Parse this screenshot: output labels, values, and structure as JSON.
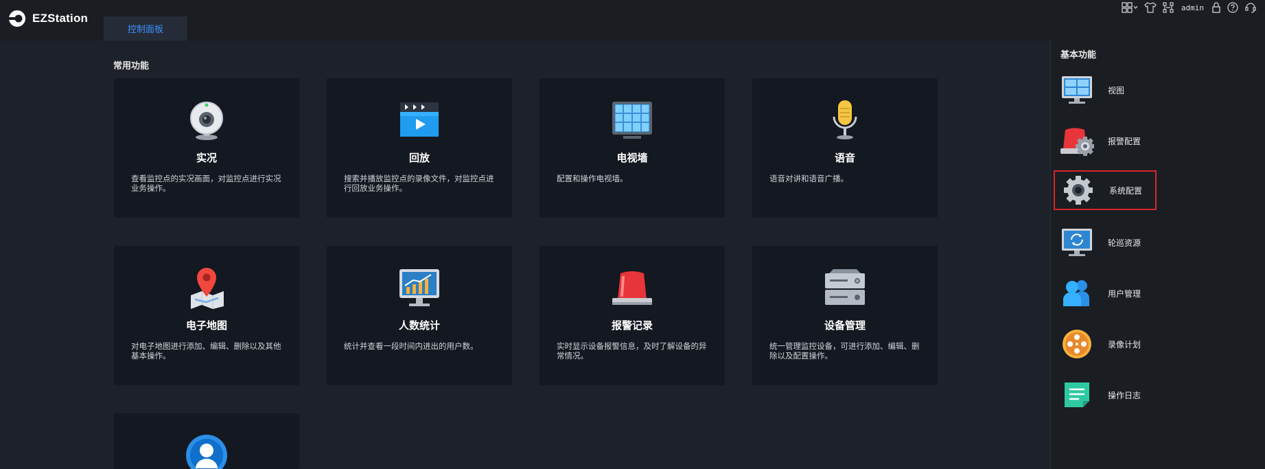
{
  "app": {
    "name": "EZStation"
  },
  "header": {
    "tab_label": "控制面板",
    "user": "admin",
    "tools": [
      "layout-grid-icon",
      "shirt-icon",
      "network-icon",
      "admin",
      "lock-icon",
      "help-icon",
      "refresh-headset-icon"
    ]
  },
  "main": {
    "section_title": "常用功能",
    "cards": [
      {
        "title": "实况",
        "desc": "查看监控点的实况画面，对监控点进行实况业务操作。",
        "icon": "webcam-icon"
      },
      {
        "title": "回放",
        "desc": "搜索并播放监控点的录像文件，对监控点进行回放业务操作。",
        "icon": "playback-clapper-icon"
      },
      {
        "title": "电视墙",
        "desc": "配置和操作电视墙。",
        "icon": "video-wall-icon"
      },
      {
        "title": "语音",
        "desc": "语音对讲和语音广播。",
        "icon": "microphone-icon"
      },
      {
        "title": "电子地图",
        "desc": "对电子地图进行添加、编辑、删除以及其他基本操作。",
        "icon": "map-pin-icon"
      },
      {
        "title": "人数统计",
        "desc": "统计并查看一段时间内进出的用户数。",
        "icon": "chart-monitor-icon"
      },
      {
        "title": "报警记录",
        "desc": "实时显示设备报警信息，及时了解设备的异常情况。",
        "icon": "alarm-light-icon"
      },
      {
        "title": "设备管理",
        "desc": "统一管理监控设备，可进行添加、编辑、删除以及配置操作。",
        "icon": "server-icon"
      },
      {
        "title": "",
        "desc": "",
        "icon": "globe-user-icon"
      }
    ]
  },
  "sidebar": {
    "title": "基本功能",
    "items": [
      {
        "label": "视图",
        "icon": "view-monitor-icon"
      },
      {
        "label": "报警配置",
        "icon": "alarm-config-icon"
      },
      {
        "label": "系统配置",
        "icon": "system-gear-icon",
        "selected": true
      },
      {
        "label": "轮巡资源",
        "icon": "patrol-monitor-icon"
      },
      {
        "label": "用户管理",
        "icon": "users-icon"
      },
      {
        "label": "录像计划",
        "icon": "film-reel-icon"
      },
      {
        "label": "操作日志",
        "icon": "log-note-icon"
      }
    ]
  },
  "colors": {
    "accent": "#3f8fff",
    "selected_border": "#d8262d",
    "background": "#1d2129",
    "card": "#141820"
  }
}
